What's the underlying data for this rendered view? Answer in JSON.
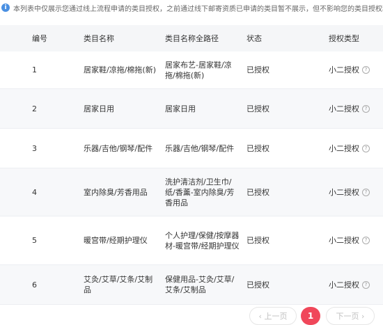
{
  "notice": {
    "text": "本列表中仅展示您通过线上流程申请的类目授权，之前通过线下邮寄资质已申请的类目暂不展示，但不影响您的类目授权和商品发"
  },
  "table": {
    "headers": [
      "编号",
      "类目名称",
      "类目名称全路径",
      "状态",
      "授权类型"
    ],
    "rows": [
      {
        "num": "1",
        "name": "居家鞋/凉拖/棉拖(新)",
        "path": "居家布艺-居家鞋/凉拖/棉拖(新)",
        "status": "已授权",
        "type": "小二授权"
      },
      {
        "num": "2",
        "name": "居家日用",
        "path": "居家日用",
        "status": "已授权",
        "type": "小二授权"
      },
      {
        "num": "3",
        "name": "乐器/吉他/钢琴/配件",
        "path": "乐器/吉他/钢琴/配件",
        "status": "已授权",
        "type": "小二授权"
      },
      {
        "num": "4",
        "name": "室内除臭/芳香用品",
        "path": "洗护清洁剂/卫生巾/纸/香薰-室内除臭/芳香用品",
        "status": "已授权",
        "type": "小二授权"
      },
      {
        "num": "5",
        "name": "暖宫带/经期护理仪",
        "path": "个人护理/保健/按摩器材-暖宫带/经期护理仪",
        "status": "已授权",
        "type": "小二授权"
      },
      {
        "num": "6",
        "name": "艾灸/艾草/艾条/艾制品",
        "path": "保健用品-艾灸/艾草/艾条/艾制品",
        "status": "已授权",
        "type": "小二授权"
      }
    ]
  },
  "pagination": {
    "prev_label": "‹ 上一页",
    "current_page": "1",
    "next_label": "下一页 ›"
  }
}
